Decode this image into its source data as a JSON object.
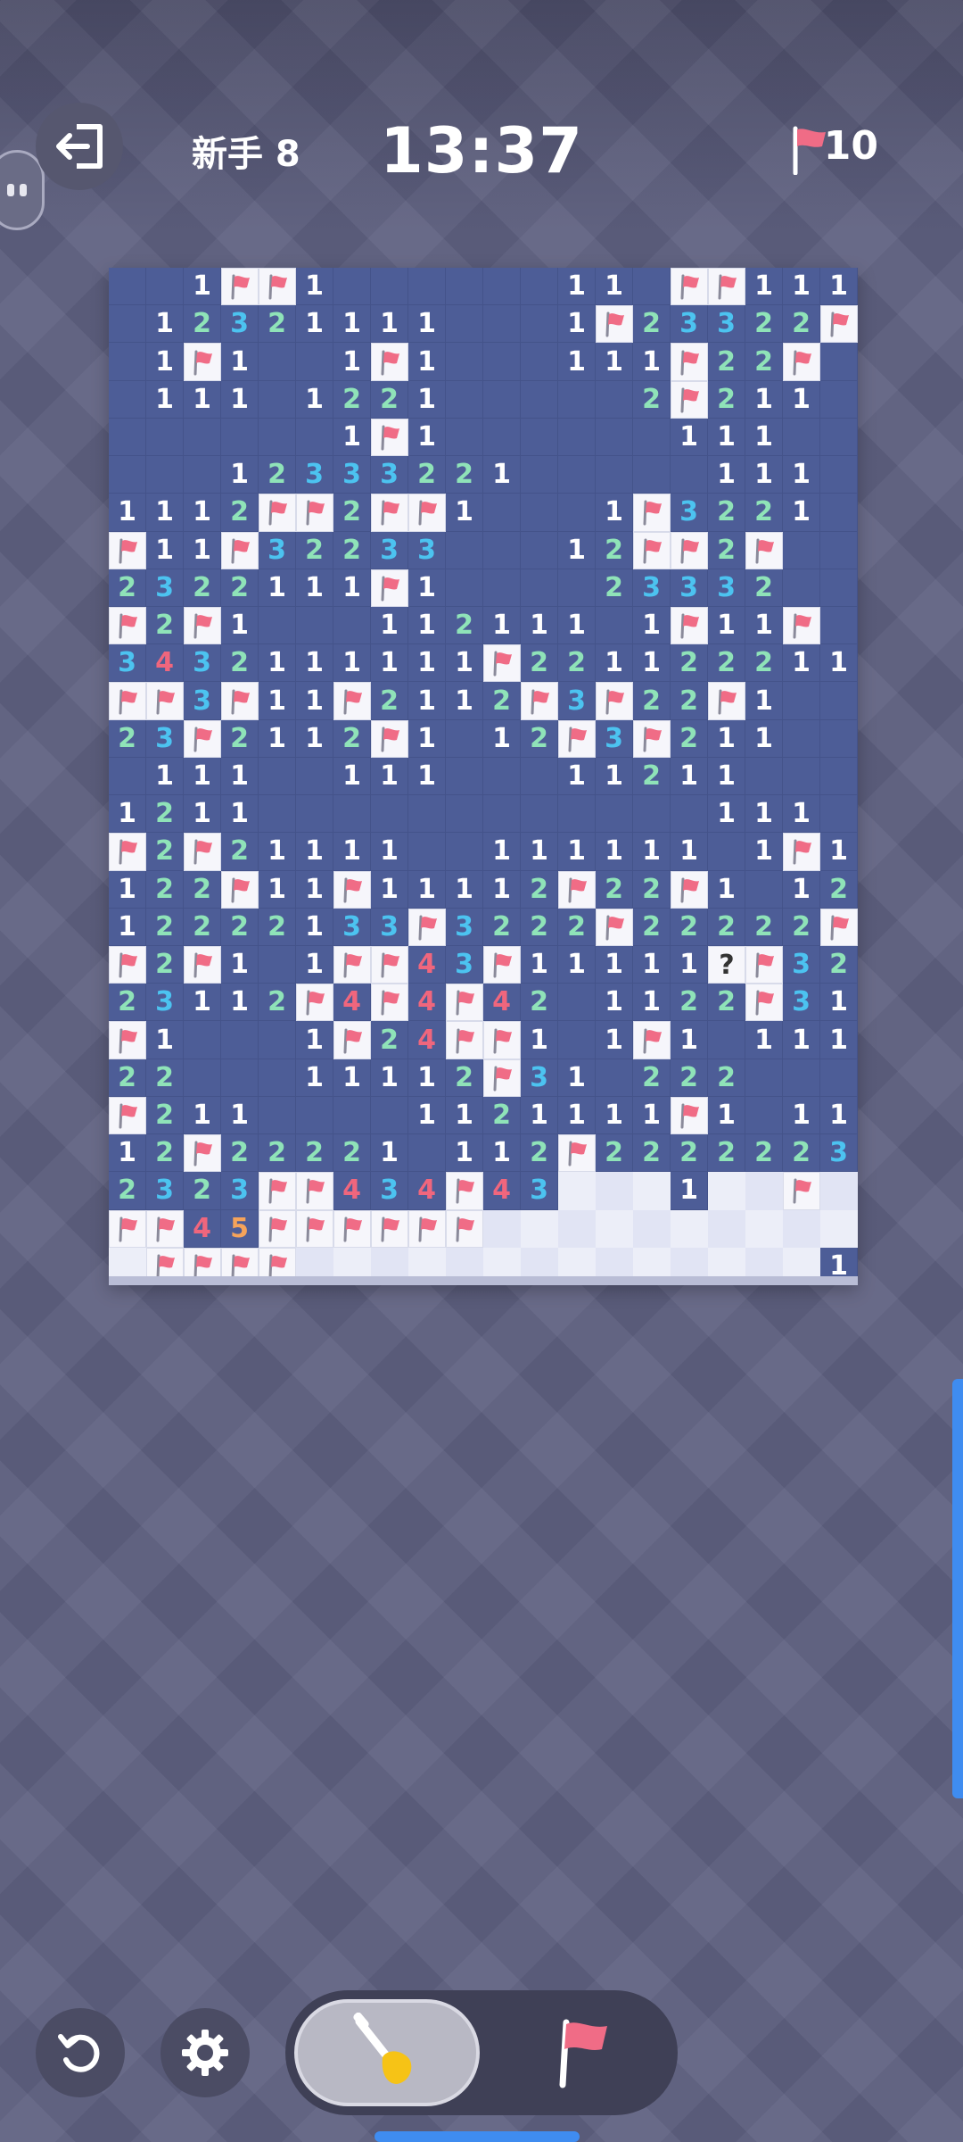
{
  "header": {
    "level_label": "新手 8",
    "timer": "13:37",
    "flags_remaining": "10"
  },
  "board": {
    "columns": 20,
    "rows": 27,
    "legend": "o=opened, h=hidden, F=flag, ?=question, digit=number",
    "grid": [
      "oo1FF1oooooo11oFF111",
      "o12321111ooo1F23322F",
      "o1F1oo1F1ooo111F22F",
      "o111o1221ooooo2F211",
      "oooooo1F1oooooo111oo",
      "ooo12333221ooooo111oo",
      "1112FF2FF1ooo1F3221",
      "F11F32233ooo12FF2F",
      "2322111F1oooo23332",
      "F2F1ooo112111o1F11F",
      "3432111111F22112221 1",
      "FF3F11F2112F3F22F1oo",
      "23F2112F1o12F3F211oo",
      "o111oo111ooo11211ooo",
      "1211oooooooooooo111",
      "F2F21111oo111111o1F1",
      "122F11F11112F22F1o12",
      "12222133F3222F22222F",
      "F2F1o1FF43F11111?F32",
      "23112F4F4F42o1122F31",
      "F1ooo1F24FF1o1F1o111",
      "22ooo11112F31o222ooo",
      "F211oooo1121111F1o11",
      "12F22221o112F22222 23F",
      "2323FF434F43hhh1hhFh",
      "FF45FFFFFFhhhhhhhhhh",
      "hFFFFhhhhhhhhhhhhhh1"
    ]
  },
  "colors": {
    "board_open": "#4d5d97",
    "board_hidden": "#eceef8",
    "number_1": "#ffffff",
    "number_2": "#8fe3b8",
    "number_3": "#4cc3f0",
    "number_4": "#f0667d",
    "number_5": "#f5a35a",
    "flag": "#f06c86",
    "accent": "#3f8cf0"
  },
  "toolbar": {
    "exit_icon": "exit-icon",
    "undo_icon": "undo-icon",
    "settings_icon": "gear-icon",
    "dig_mode_icon": "shovel-icon",
    "flag_mode_icon": "flag-icon",
    "active_mode": "dig"
  }
}
